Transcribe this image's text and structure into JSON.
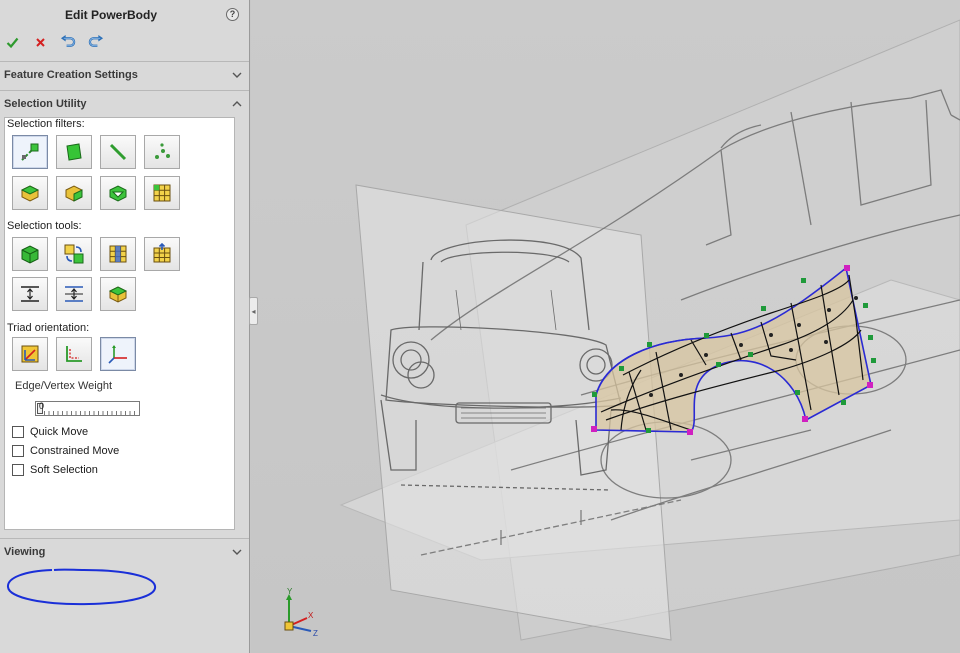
{
  "panel": {
    "title": "Edit PowerBody",
    "help_glyph": "?",
    "actions": [
      {
        "name": "ok-button",
        "icon": "check-icon"
      },
      {
        "name": "cancel-button",
        "icon": "x-icon"
      },
      {
        "name": "undo-button",
        "icon": "undo-icon"
      },
      {
        "name": "redo-button",
        "icon": "redo-icon"
      }
    ]
  },
  "sections": {
    "feature_creation": "Feature Creation Settings",
    "selection_utility": "Selection Utility",
    "viewing": "Viewing"
  },
  "selection_utility": {
    "filters_label": "Selection filters:",
    "tools_label": "Selection tools:",
    "triad_label": "Triad orientation:",
    "weight_label": "Edge/Vertex Weight",
    "weight_value": "0",
    "checkboxes": [
      {
        "label": "Quick Move",
        "checked": false
      },
      {
        "label": "Constrained Move",
        "checked": false
      },
      {
        "label": "Soft Selection",
        "checked": false
      }
    ]
  },
  "viewport": {
    "triad_axes": {
      "y": "Y",
      "x": "X",
      "z": "Z"
    }
  },
  "colors": {
    "panel_bg": "#d9d9d9",
    "viewport_bg": "#c8c8c8",
    "surface_fill": "#d8c5a0",
    "surface_edge": "#2a2ad4",
    "handle_green": "#1f9a3a",
    "handle_magenta": "#d020c0",
    "annotation_blue": "#1a2fd8"
  }
}
